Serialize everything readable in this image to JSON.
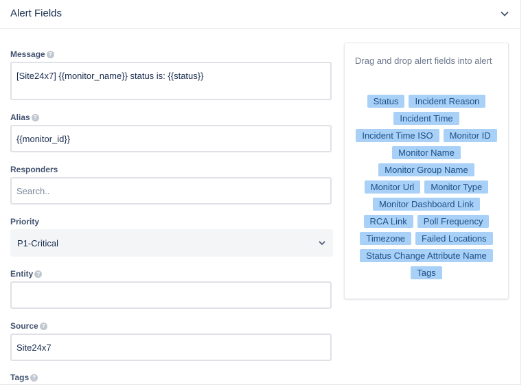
{
  "section": {
    "title": "Alert Fields"
  },
  "fields": {
    "message": {
      "label": "Message",
      "value": "[Site24x7] {{monitor_name}} status is: {{status}}"
    },
    "alias": {
      "label": "Alias",
      "value": "{{monitor_id}}"
    },
    "responders": {
      "label": "Responders",
      "placeholder": "Search.."
    },
    "priority": {
      "label": "Priority",
      "value": "P1-Critical"
    },
    "entity": {
      "label": "Entity",
      "value": ""
    },
    "source": {
      "label": "Source",
      "value": "Site24x7"
    },
    "tags_partial": {
      "label": "Tags"
    }
  },
  "panel": {
    "hint": "Drag and drop alert fields into alert",
    "tags": [
      "Status",
      "Incident Reason",
      "Incident Time",
      "Incident Time ISO",
      "Monitor ID",
      "Monitor Name",
      "Monitor Group Name",
      "Monitor Url",
      "Monitor Type",
      "Monitor Dashboard Link",
      "RCA Link",
      "Poll Frequency",
      "Timezone",
      "Failed Locations",
      "Status Change Attribute Name",
      "Tags"
    ]
  },
  "icons": {
    "help": "question-circle-icon",
    "collapse": "chevron-down-icon",
    "dropdown": "chevron-down-icon"
  },
  "colors": {
    "tag_bg": "#a9d1f8",
    "tag_text": "#1d4f86",
    "field_border": "#dfe1e6"
  }
}
